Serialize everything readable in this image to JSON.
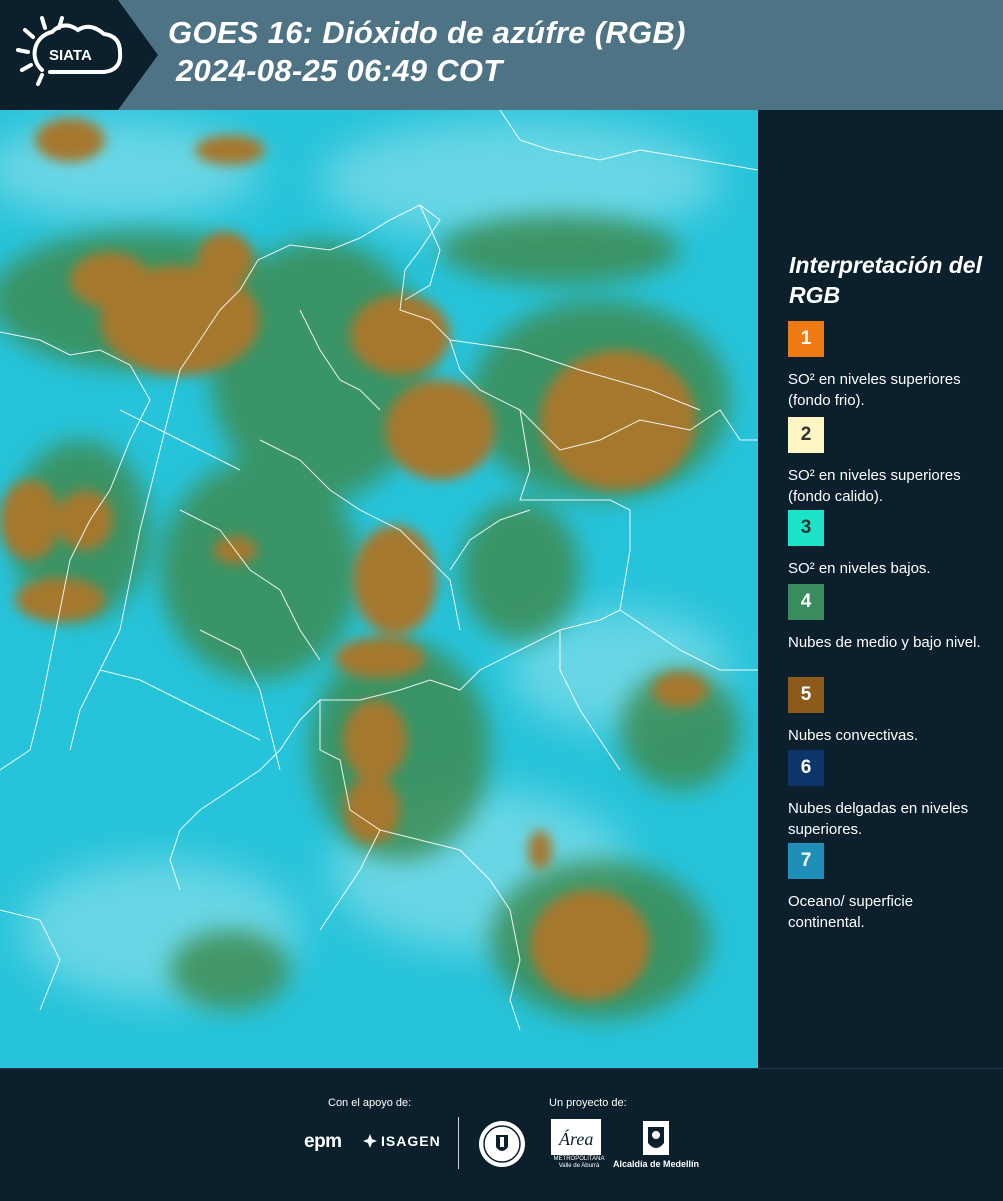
{
  "header": {
    "logo_text": "SIATA",
    "title_line1": "GOES 16: Dióxido de azúfre (RGB)",
    "title_line2": "2024-08-25 06:49 COT"
  },
  "legend": {
    "title": "Interpretación del RGB",
    "items": [
      {
        "number": "1",
        "color": "#f07b15",
        "text": "SO² en niveles superiores (fondo frio)."
      },
      {
        "number": "2",
        "color": "#fef7c5",
        "text": "SO² en niveles superiores (fondo calido)."
      },
      {
        "number": "3",
        "color": "#1de4c9",
        "text": "SO² en niveles bajos."
      },
      {
        "number": "4",
        "color": "#3a8b5e",
        "text": "Nubes de medio y bajo nivel."
      },
      {
        "number": "5",
        "color": "#8c5a1a",
        "text": "Nubes convectivas."
      },
      {
        "number": "6",
        "color": "#0d356a",
        "text": "Nubes delgadas en niveles superiores."
      },
      {
        "number": "7",
        "color": "#1f8fb8",
        "text": "Oceano/ superficie continental."
      }
    ]
  },
  "footer": {
    "support_label": "Con el apoyo de:",
    "project_label": "Un proyecto de:",
    "sponsors": [
      "epm",
      "ISAGEN"
    ],
    "area_name": "Área",
    "area_subtitle": "METROPOLITANA Valle de Aburrá",
    "alcaldia": "Alcaldía de Medellín"
  },
  "colors": {
    "background": "#0b1f2c",
    "header_band": "#4e7384",
    "map_base": "#27c3da",
    "convective": "#a5782e",
    "mid_clouds": "#3c8c52"
  }
}
